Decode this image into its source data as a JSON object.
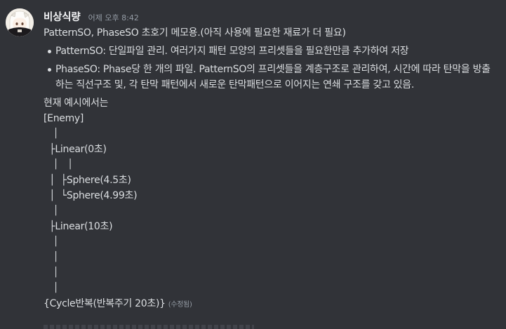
{
  "message": {
    "username": "비상식량",
    "timestamp": "어제 오후 8:42",
    "intro": "PatternSO, PhaseSO 초호기 메모용.(아직 사용에 필요한 재료가 더 필요)",
    "bullets": [
      "PatternSO: 단일파일 관리. 여러가지 패턴 모양의 프리셋들을 필요한만큼 추가하여 저장",
      "PhaseSO: Phase당 한 개의 파일. PatternSO의 프리셋들을 계층구조로 관리하여, 시간에 따라 탄막을 방출하는 직선구조 및, 각 탄막 패턴에서 새로운 탄막패턴으로 이어지는 연쇄 구조를 갖고 있음."
    ],
    "example_heading": "현재 예시에서는",
    "tree": [
      "[Enemy]",
      "  │",
      "  ├Linear(0초)",
      "  │  │",
      "  │  ├Sphere(4.5초)",
      "  │  └Sphere(4.99초)",
      "  │",
      "  ├Linear(10초)",
      "  │",
      "  │",
      "  │",
      "  │"
    ],
    "last_line": "{Cycle반복(반복주기 20초)}",
    "edited_label": "(수정됨)"
  }
}
